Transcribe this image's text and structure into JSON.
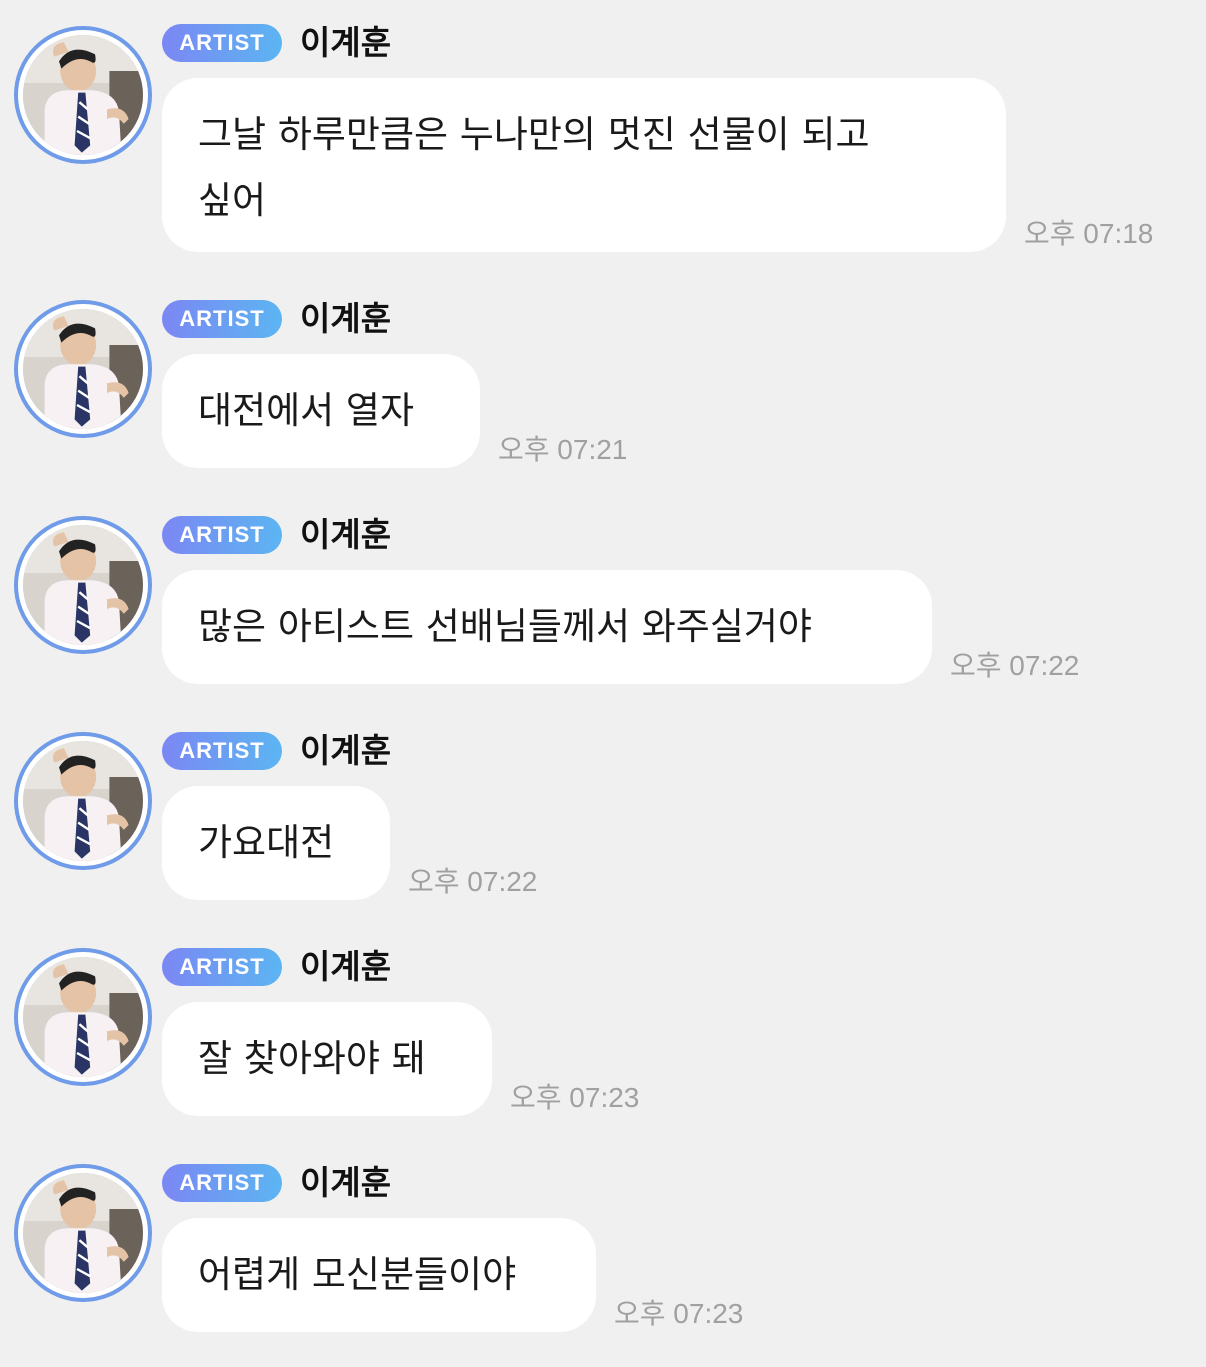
{
  "sender": {
    "badge": "ARTIST",
    "name": "이계훈",
    "avatar_icon": "profile-photo",
    "ring_color": "#6f9be8"
  },
  "colors": {
    "background": "#f0f0f0",
    "bubble": "#ffffff",
    "badge_gradient_start": "#7b87f3",
    "badge_gradient_end": "#5cb5f2",
    "time_text": "#a0a0a0"
  },
  "messages": [
    {
      "text": "그날 하루만큼은 누나만의 멋진 선물이 되고\n싶어",
      "time": "오후 07:18"
    },
    {
      "text": "대전에서 열자",
      "time": "오후 07:21"
    },
    {
      "text": "많은 아티스트 선배님들께서 와주실거야",
      "time": "오후 07:22"
    },
    {
      "text": "가요대전",
      "time": "오후 07:22"
    },
    {
      "text": "잘 찾아와야 돼",
      "time": "오후 07:23"
    },
    {
      "text": "어렵게 모신분들이야",
      "time": "오후 07:23"
    }
  ]
}
